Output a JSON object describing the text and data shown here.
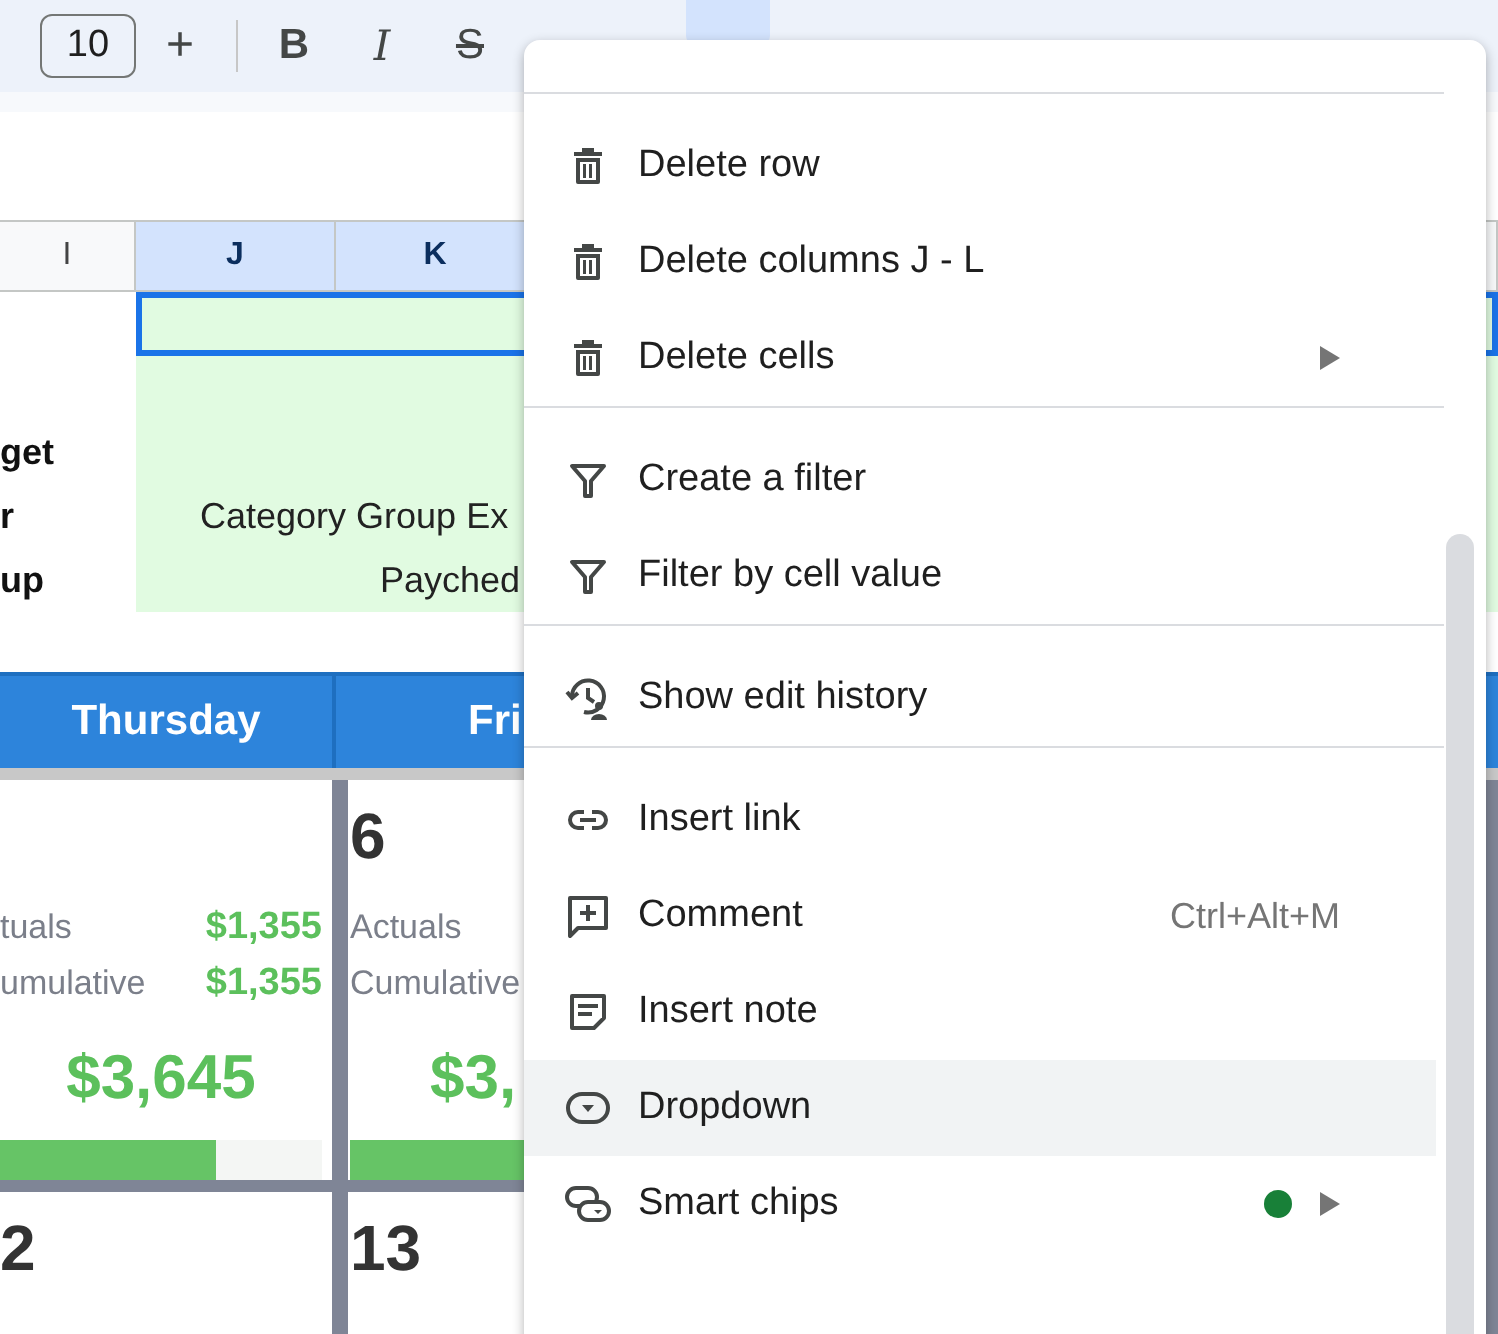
{
  "toolbar": {
    "font_size": "10",
    "increase": "+",
    "format_buttons": [
      {
        "kind": "bold",
        "label": "B"
      },
      {
        "kind": "italic",
        "label": "I"
      },
      {
        "kind": "strikethrough",
        "label": "S"
      }
    ],
    "merge_active": true
  },
  "columns": [
    {
      "label": "I",
      "selected": false
    },
    {
      "label": "J",
      "selected": true
    },
    {
      "label": "K",
      "selected": true
    }
  ],
  "row_labels": [
    "get",
    "r",
    "up"
  ],
  "row_values": [
    "Category Group Ex",
    "Payched"
  ],
  "calendar": {
    "days": [
      "Thursday",
      "Fri"
    ],
    "weeks": [
      [
        {
          "rows": [
            {
              "label": "tuals",
              "value": "$1,355"
            },
            {
              "label": "umulative",
              "value": "$1,355"
            }
          ],
          "total": "$3,645",
          "level": 0.67
        },
        {
          "day": "6",
          "rows": [
            {
              "label": "Actuals"
            },
            {
              "label": "Cumulative"
            }
          ],
          "total": "$3,",
          "level": 0.6
        }
      ],
      [
        {
          "day": "2"
        },
        {
          "day": "13"
        }
      ]
    ]
  },
  "menu": [
    {
      "kind": "divider"
    },
    {
      "kind": "trash",
      "label": "Delete row",
      "selected": false
    },
    {
      "kind": "trash",
      "label": "Delete columns J - L",
      "selected": false
    },
    {
      "kind": "trash",
      "label": "Delete cells",
      "submenu": true,
      "selected": false
    },
    {
      "kind": "divider"
    },
    {
      "kind": "filter",
      "label": "Create a filter",
      "selected": false
    },
    {
      "kind": "filter",
      "label": "Filter by cell value",
      "selected": false
    },
    {
      "kind": "divider"
    },
    {
      "kind": "history",
      "label": "Show edit history",
      "selected": false
    },
    {
      "kind": "divider"
    },
    {
      "kind": "link",
      "label": "Insert link",
      "selected": false
    },
    {
      "kind": "comment",
      "label": "Comment",
      "shortcut": "Ctrl+Alt+M",
      "selected": false
    },
    {
      "kind": "note",
      "label": "Insert note",
      "selected": false
    },
    {
      "kind": "dropdown",
      "label": "Dropdown",
      "selected": true
    },
    {
      "kind": "chips",
      "label": "Smart chips",
      "dot": true,
      "submenu": true,
      "selected": false
    }
  ]
}
